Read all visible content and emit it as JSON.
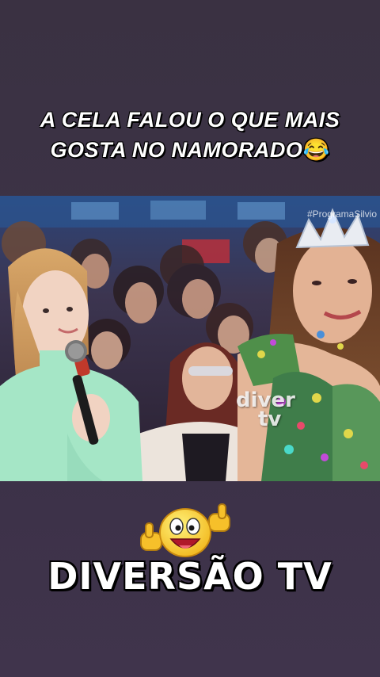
{
  "caption": {
    "line1": "A CELA FALOU O QUE MAIS",
    "line2": "GOSTA NO NAMORADO",
    "emoji": "😂"
  },
  "video": {
    "hashtag": "#ProgramaSilvio",
    "watermark_line1": "diver",
    "watermark_line2": "tv"
  },
  "brand": {
    "title": "DIVERSÃO TV",
    "mascot_icon": "smiley-thumbs-up-icon"
  },
  "colors": {
    "background": "#3b3147",
    "caption_text": "#ffffff",
    "outfit_mint": "#9fe6c2",
    "mascot_yellow": "#f7c92a"
  }
}
